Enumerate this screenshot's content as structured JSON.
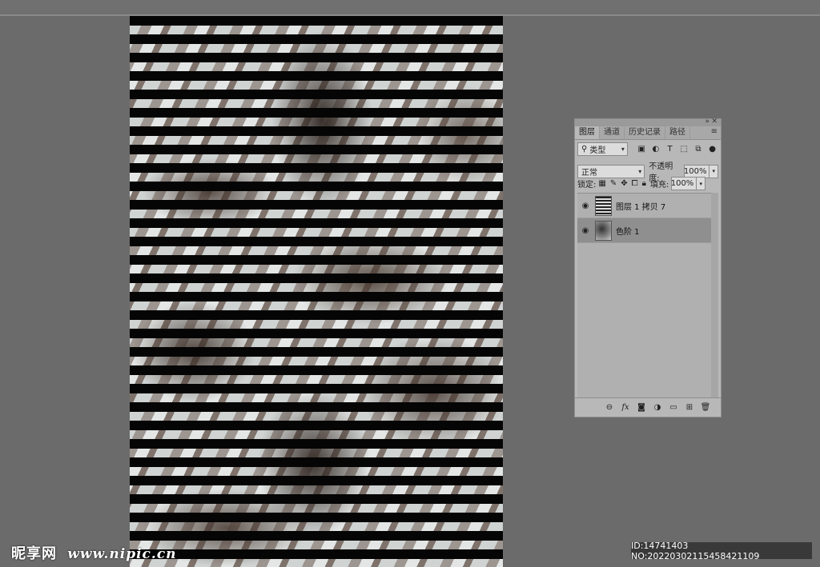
{
  "tabs": [
    {
      "label": "图层",
      "active": true
    },
    {
      "label": "通道",
      "active": false
    },
    {
      "label": "历史记录",
      "active": false
    },
    {
      "label": "路径",
      "active": false
    }
  ],
  "filter": {
    "label": "类型"
  },
  "filter_icons": [
    "image-filter-icon",
    "adjustment-filter-icon",
    "type-filter-icon",
    "shape-filter-icon",
    "smart-object-filter-icon",
    "filter-toggle-icon"
  ],
  "blend": {
    "mode": "正常",
    "opacity_label": "不透明度:",
    "opacity_value": "100%"
  },
  "lock": {
    "label": "锁定:",
    "fill_label": "填充:",
    "fill_value": "100%"
  },
  "layers": [
    {
      "name": "图层 1 拷贝 7",
      "thumb": "stripe",
      "selected": false
    },
    {
      "name": "色阶 1",
      "thumb": "photo",
      "selected": true
    }
  ],
  "watermark": {
    "brand": "昵享网",
    "url": "www.nipic.cn"
  },
  "image_id": "ID:14741403 NO:20220302115458421109",
  "colors": {
    "canvas_bg": "#6b6b6b",
    "panel_bg": "#b8b8b8",
    "stripe": "#050505",
    "selected_layer": "#8f8f8f"
  }
}
